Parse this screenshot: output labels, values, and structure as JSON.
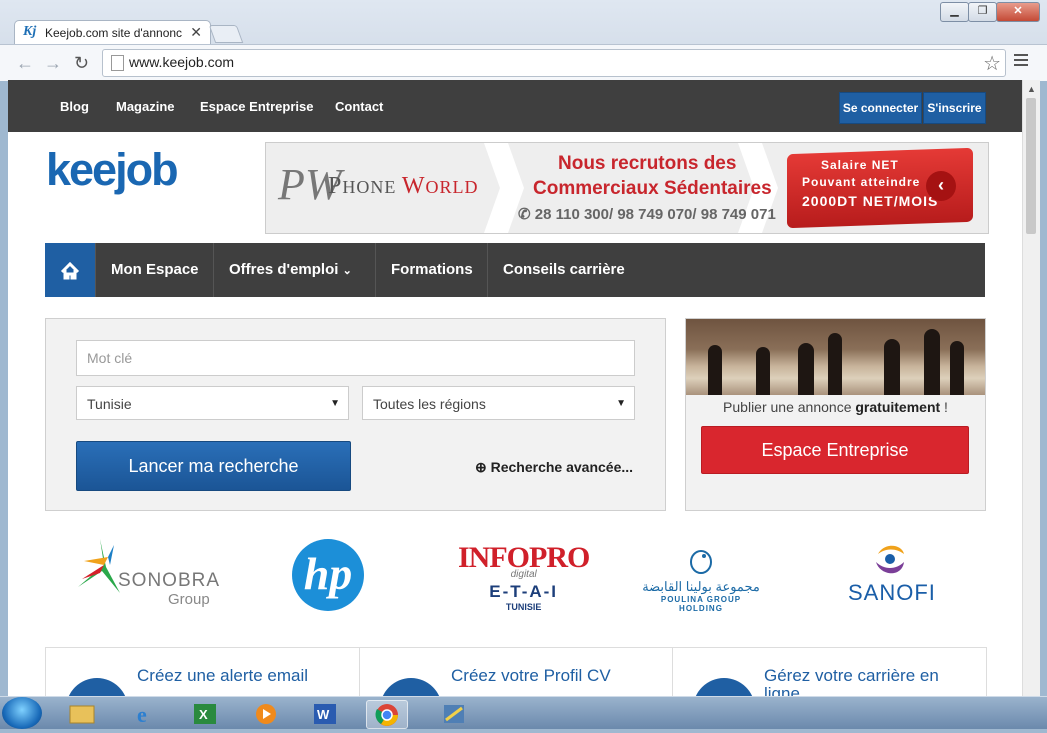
{
  "browser": {
    "tab_title": "Keejob.com site d'annonc",
    "tab_favicon": "Kj",
    "url": "www.keejob.com"
  },
  "site": {
    "top_nav": [
      "Blog",
      "Magazine",
      "Espace Entreprise",
      "Contact"
    ],
    "login_label": "Se connecter",
    "signup_label": "S'inscrire",
    "logo_text": "keejob",
    "banner": {
      "monogram": "PW",
      "brand_first": "P",
      "brand_rest_1": "HONE ",
      "brand_second": "W",
      "brand_rest_2": "ORLD",
      "headline_1": "Nous recrutons des",
      "headline_2": "Commerciaux Sédentaires",
      "phones": "28 110 300/ 98 749 070/ 98 749 071",
      "salary_1": "Salaire NET",
      "salary_2": "Pouvant atteindre",
      "salary_3": "2000DT NET/MOIS"
    },
    "main_nav": [
      "Mon Espace",
      "Offres d'emploi",
      "Formations",
      "Conseils carrière"
    ],
    "search": {
      "keyword_placeholder": "Mot clé",
      "country_value": "Tunisie",
      "region_value": "Toutes les régions",
      "submit_label": "Lancer ma recherche",
      "advanced_label": "Recherche avancée..."
    },
    "enterprise": {
      "publish_text_1": "Publier une annonce ",
      "publish_text_bold": "gratuitement",
      "publish_text_2": " !",
      "button_label": "Espace Entreprise"
    },
    "partners": {
      "sonobra": "SONOBRA",
      "sonobra_sub": "Group",
      "hp": "hp",
      "infopro": "INFOPRO",
      "infopro_sub": "digital",
      "etai": "E-T-A-I",
      "etai_sub": "TUNISIE",
      "poulina_ar": "مجموعة بولينا القابضة",
      "poulina_en": "POULINA GROUP HOLDING",
      "sanofi": "SANOFI"
    },
    "features": [
      "Créez une alerte email",
      "Créez votre Profil CV",
      "Gérez votre carrière en ligne"
    ]
  },
  "colors": {
    "brand_blue": "#1f5fa3",
    "brand_red": "#d9262e",
    "nav_dark": "#3f3f3f"
  }
}
